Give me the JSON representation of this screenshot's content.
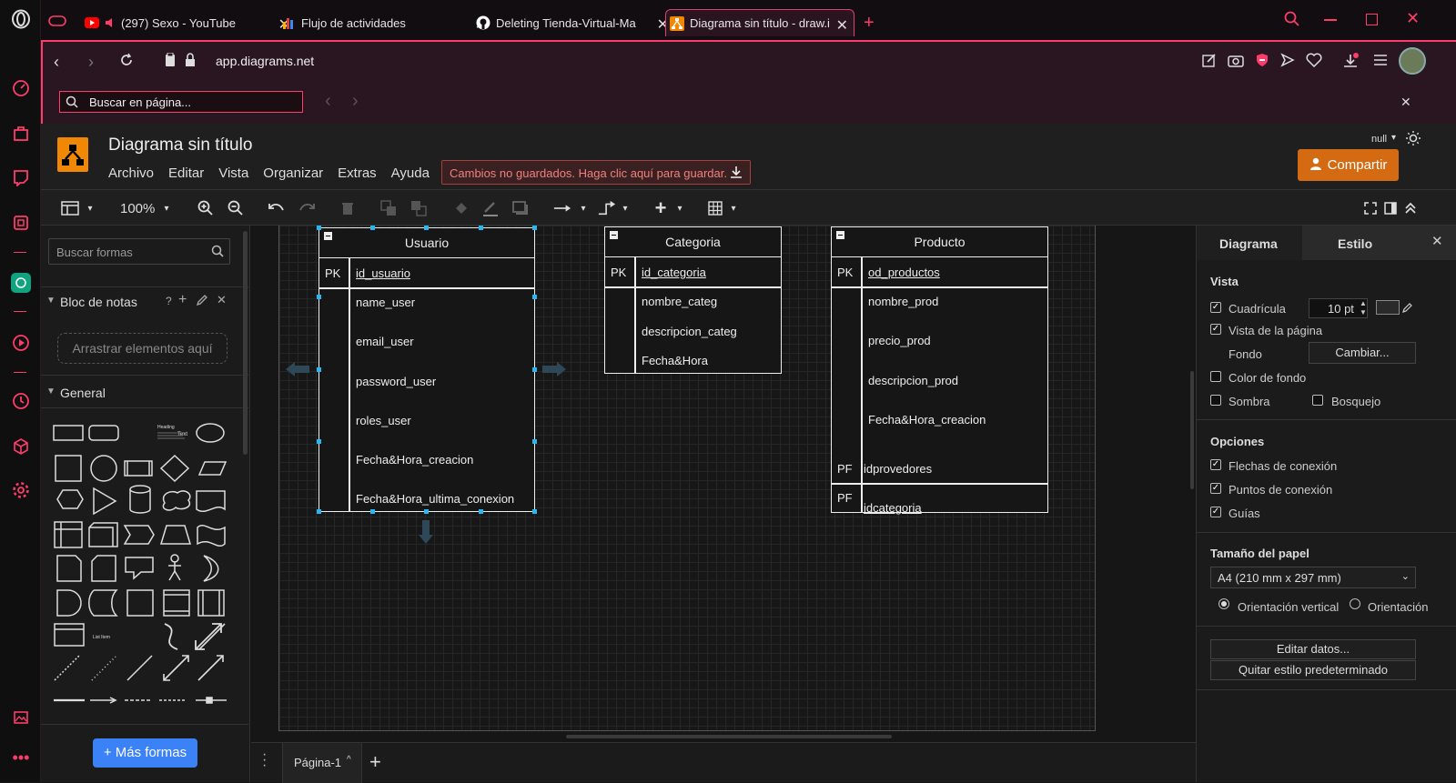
{
  "browser": {
    "tabs": [
      {
        "title": "(297) Sexo - YouTube",
        "icon": "youtube-icon"
      },
      {
        "title": "Flujo de actividades",
        "icon": "bar-chart-icon"
      },
      {
        "title": "Deleting Tienda-Virtual-Ma",
        "icon": "github-icon"
      },
      {
        "title": "Diagrama sin título - draw.i",
        "icon": "drawio-icon",
        "active": true
      }
    ],
    "url": "app.diagrams.net",
    "find_placeholder": "Buscar en página..."
  },
  "drawio": {
    "title": "Diagrama sin título",
    "menu": [
      "Archivo",
      "Editar",
      "Vista",
      "Organizar",
      "Extras",
      "Ayuda"
    ],
    "unsaved_notice": "Cambios no guardados. Haga clic aquí para guardar.",
    "share_label": "Compartir",
    "user_label": "null",
    "zoom": "100%"
  },
  "left_panel": {
    "search_placeholder": "Buscar formas",
    "scratchpad_title": "Bloc de notas",
    "scratchpad_help": "?",
    "drop_here": "Arrastrar elementos aquí",
    "general_title": "General",
    "more_shapes": "+ Más formas",
    "mini_text": "Text",
    "mini_heading": "Heading",
    "mini_list": "List Item"
  },
  "diagram": {
    "tables": [
      {
        "name": "Usuario",
        "pk_label": "PK",
        "pk": "id_usuario",
        "fields": [
          "name_user",
          "email_user",
          "password_user",
          "roles_user",
          "Fecha&Hora_creacion",
          "Fecha&Hora_ultima_conexion"
        ]
      },
      {
        "name": "Categoria",
        "pk_label": "PK",
        "pk": "id_categoria",
        "fields": [
          "nombre_categ",
          "descripcion_categ",
          "Fecha&Hora"
        ]
      },
      {
        "name": "Producto",
        "pk_label": "PK",
        "pk": "od_productos",
        "fields": [
          "nombre_prod",
          "precio_prod",
          "descripcion_prod",
          "Fecha&Hora_creacion"
        ],
        "fk_rows": [
          {
            "label": "PF",
            "name": "idprovedores"
          },
          {
            "label": "PF",
            "name": "idcategoria"
          }
        ]
      }
    ]
  },
  "page_bar": {
    "page_name": "Página-1"
  },
  "right_panel": {
    "tabs": [
      "Diagrama",
      "Estilo"
    ],
    "vista_title": "Vista",
    "grid_label": "Cuadrícula",
    "grid_size": "10 pt",
    "page_view_label": "Vista de la página",
    "background_label": "Fondo",
    "change_button": "Cambiar...",
    "bg_color_label": "Color de fondo",
    "shadow_label": "Sombra",
    "sketch_label": "Bosquejo",
    "options_title": "Opciones",
    "connection_arrows": "Flechas de conexión",
    "connection_points": "Puntos de conexión",
    "guides": "Guías",
    "paper_title": "Tamaño del papel",
    "paper_value": "A4 (210 mm x 297 mm)",
    "portrait": "Orientación vertical",
    "landscape": "Orientación",
    "edit_data": "Editar datos...",
    "clear_style": "Quitar estilo predeterminado"
  },
  "colors": {
    "accent": "#ff3b6b",
    "share": "#d46a12",
    "more_shapes": "#3b82f6",
    "selection": "#29b6f2"
  }
}
